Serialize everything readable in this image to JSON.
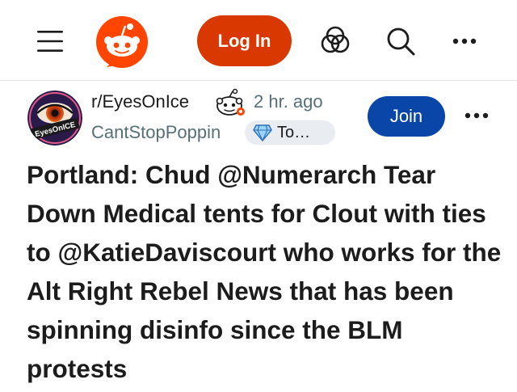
{
  "header": {
    "menu_icon": "hamburger-menu-icon",
    "logo_icon": "reddit-logo-icon",
    "login_label": "Log In",
    "actions": [
      {
        "icon": "chat-bubbles-icon"
      },
      {
        "icon": "search-icon"
      },
      {
        "icon": "more-horizontal-icon"
      }
    ]
  },
  "post": {
    "subreddit": "r/EyesOnIce",
    "avatar_text": "EyesOnICE",
    "time": "2 hr. ago",
    "author": "CantStopPoppin",
    "flair": "To…",
    "join_label": "Join",
    "title": "Portland: Chud @Numerarch Tear Down Medical tents for Clout with ties to @KatieDaviscourt who works for the Alt Right Rebel News that has been spinning disinfo since the BLM protests"
  },
  "colors": {
    "brand_orange": "#ff4500",
    "login_bg": "#d93900",
    "join_bg": "#0a45a8",
    "meta_gray": "#576f76",
    "flair_bg": "#e9edf1"
  }
}
